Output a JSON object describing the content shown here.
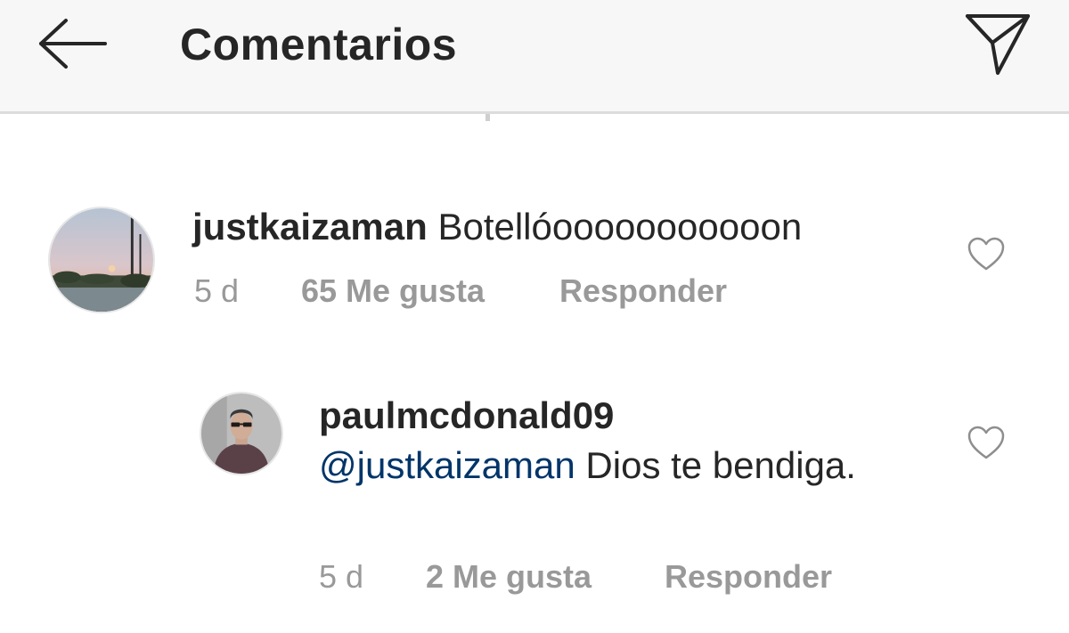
{
  "header": {
    "title": "Comentarios",
    "back_icon": "arrow-left-icon",
    "share_icon": "paper-plane-icon"
  },
  "comments": [
    {
      "username": "justkaizaman",
      "text": " Botellóooooooooooon",
      "time": "5 d",
      "likes": "65 Me gusta",
      "reply_label": "Responder",
      "avatar_icon": "sunset-cityscape-avatar",
      "like_icon": "heart-outline-icon"
    },
    {
      "username": "paulmcdonald09",
      "mention": "@justkaizaman",
      "text": " Dios te bendiga.",
      "emoji": "🙏",
      "time": "5 d",
      "likes": "2 Me gusta",
      "reply_label": "Responder",
      "avatar_icon": "person-portrait-avatar",
      "like_icon": "heart-outline-icon"
    }
  ],
  "colors": {
    "header_bg": "#f7f7f7",
    "text_primary": "#262626",
    "text_secondary": "#999999",
    "mention": "#003569"
  }
}
